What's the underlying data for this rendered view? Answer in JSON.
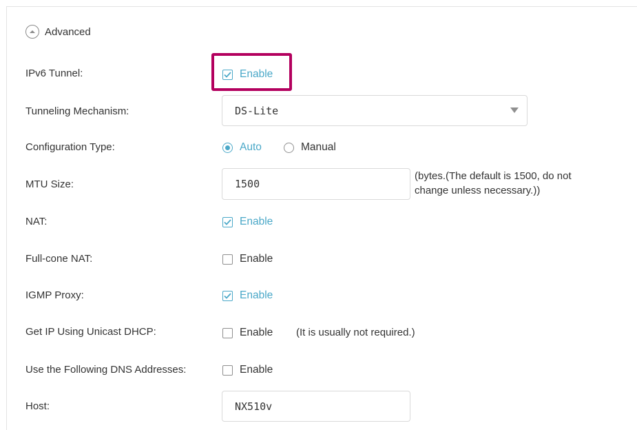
{
  "advanced": {
    "label": "Advanced",
    "icon": "chevron-up-circle-icon"
  },
  "ipv6_tunnel": {
    "label": "IPv6 Tunnel:",
    "option": "Enable",
    "checked": true
  },
  "tunneling": {
    "label": "Tunneling Mechanism:",
    "value": "DS-Lite"
  },
  "config_type": {
    "label": "Configuration Type:",
    "options": [
      "Auto",
      "Manual"
    ],
    "selected": "Auto"
  },
  "mtu": {
    "label": "MTU Size:",
    "value": "1500",
    "note_line1": "(bytes.(The default is 1500, do not",
    "note_line2": "change unless necessary.))"
  },
  "nat": {
    "label": "NAT:",
    "option": "Enable",
    "checked": true
  },
  "full_cone_nat": {
    "label": "Full-cone NAT:",
    "option": "Enable",
    "checked": false
  },
  "igmp_proxy": {
    "label": "IGMP Proxy:",
    "option": "Enable",
    "checked": true
  },
  "unicast_dhcp": {
    "label": "Get IP Using Unicast DHCP:",
    "option": "Enable",
    "checked": false,
    "note": "(It is usually not required.)"
  },
  "dns": {
    "label": "Use the Following DNS Addresses:",
    "option": "Enable",
    "checked": false
  },
  "host": {
    "label": "Host:",
    "value": "NX510v"
  },
  "colors": {
    "accent": "#4aa8c8",
    "highlight": "#b3005e"
  }
}
